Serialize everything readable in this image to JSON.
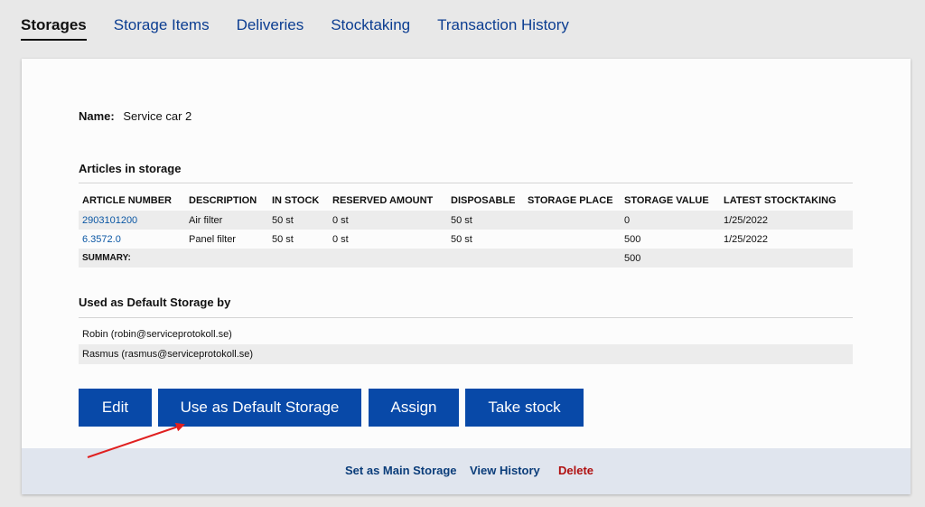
{
  "tabs": [
    {
      "label": "Storages",
      "active": true
    },
    {
      "label": "Storage Items"
    },
    {
      "label": "Deliveries"
    },
    {
      "label": "Stocktaking"
    },
    {
      "label": "Transaction History"
    }
  ],
  "storage": {
    "name_label": "Name:",
    "name_value": "Service car 2"
  },
  "articles": {
    "title": "Articles in storage",
    "columns": [
      "ARTICLE NUMBER",
      "DESCRIPTION",
      "IN STOCK",
      "RESERVED AMOUNT",
      "DISPOSABLE",
      "STORAGE PLACE",
      "STORAGE VALUE",
      "LATEST STOCKTAKING"
    ],
    "rows": [
      [
        "2903101200",
        "Air filter",
        "50 st",
        "0 st",
        "50 st",
        "",
        "0",
        "1/25/2022"
      ],
      [
        "6.3572.0",
        "Panel filter",
        "50 st",
        "0 st",
        "50 st",
        "",
        "500",
        "1/25/2022"
      ]
    ],
    "summary_label": "SUMMARY:",
    "summary_value": "500"
  },
  "default_storage": {
    "title": "Used as Default Storage by",
    "users": [
      "Robin (robin@serviceprotokoll.se)",
      "Rasmus (rasmus@serviceprotokoll.se)"
    ]
  },
  "buttons": {
    "edit": "Edit",
    "use_default": "Use as Default Storage",
    "assign": "Assign",
    "take_stock": "Take stock"
  },
  "footer": {
    "set_main": "Set as Main Storage",
    "view_history": "View History",
    "delete": "Delete"
  },
  "colors": {
    "primary": "#0849a8",
    "link": "#0b57a4",
    "danger": "#b01010",
    "annotation": "#e02020"
  }
}
